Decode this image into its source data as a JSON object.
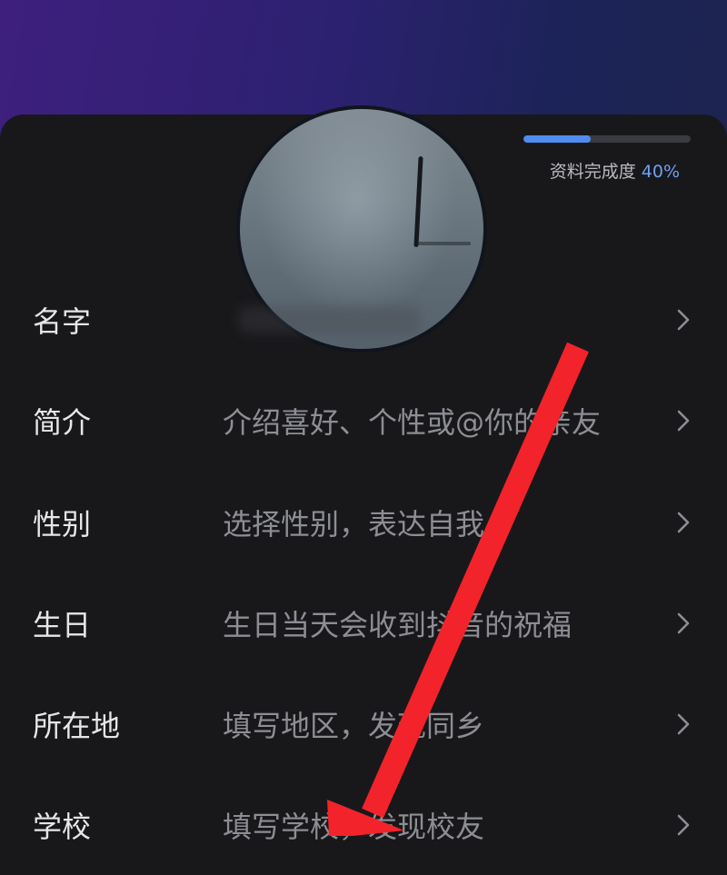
{
  "profile": {
    "completion_label": "资料完成度",
    "completion_percent_text": "40%",
    "completion_fraction": 0.4
  },
  "accent_colors": {
    "progress": "#4f8cf0",
    "arrow": "#f2232a",
    "header_gradient_start": "#3e1f7e"
  },
  "fields": [
    {
      "label": "名字",
      "value": ""
    },
    {
      "label": "简介",
      "value": "介绍喜好、个性或@你的亲友"
    },
    {
      "label": "性别",
      "value": "选择性别，表达自我"
    },
    {
      "label": "生日",
      "value": "生日当天会收到抖音的祝福"
    },
    {
      "label": "所在地",
      "value": "填写地区，发现同乡"
    },
    {
      "label": "学校",
      "value": "填写学校，发现校友"
    }
  ],
  "icons": {
    "chevron": "chevron-right-icon",
    "annotation": "red-arrow-annotation"
  }
}
